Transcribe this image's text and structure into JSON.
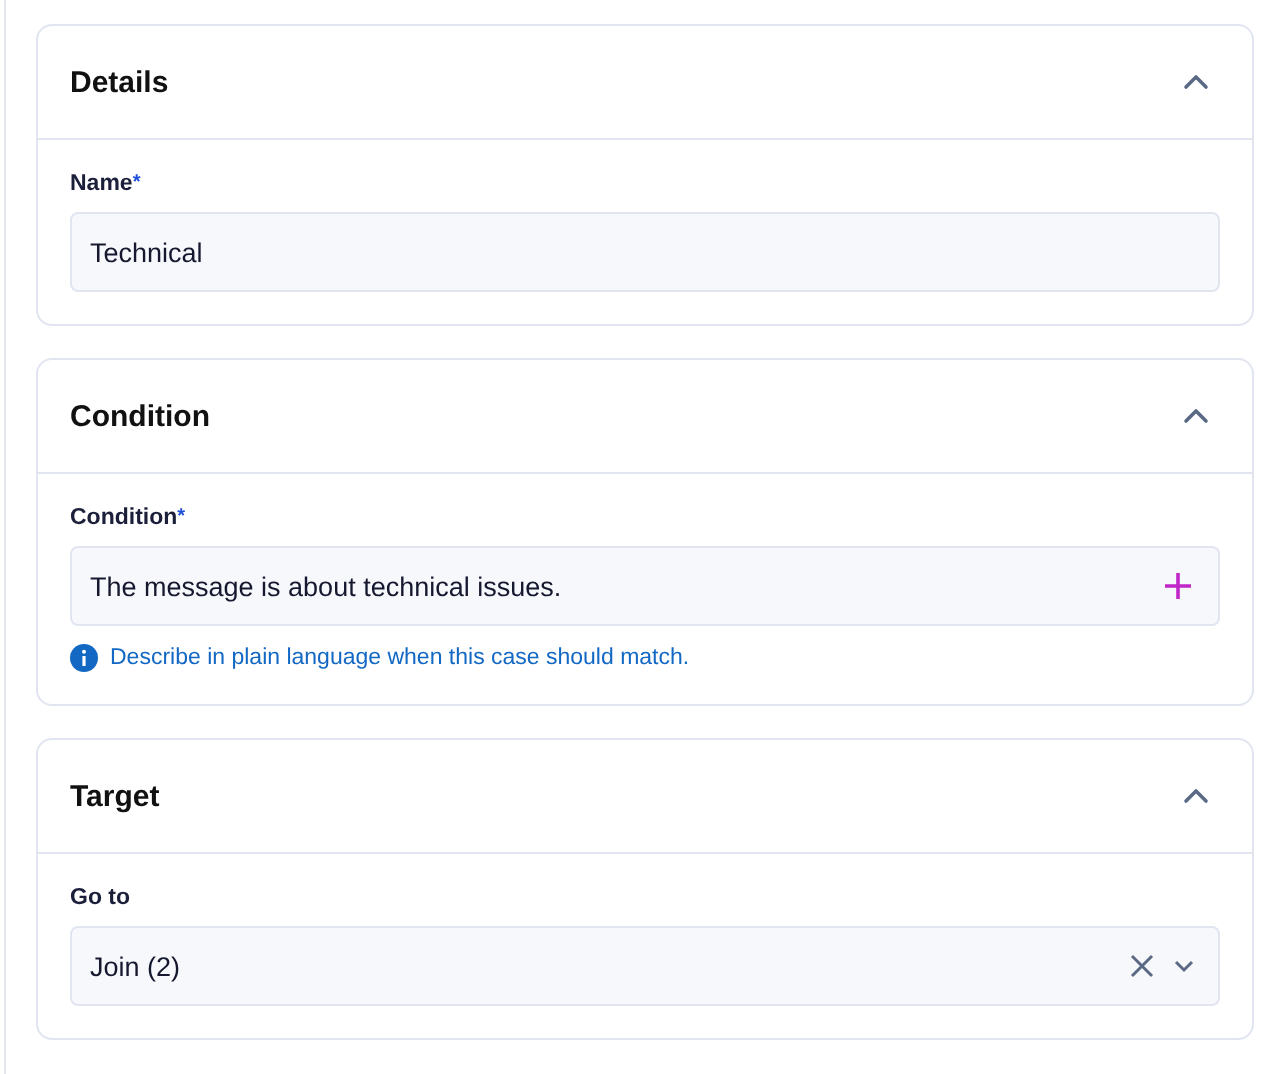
{
  "sections": [
    {
      "title": "Details",
      "expanded": true,
      "field": {
        "kind": "text",
        "label": "Name",
        "required_mark": "*",
        "value": "Technical"
      }
    },
    {
      "title": "Condition",
      "expanded": true,
      "field": {
        "kind": "text_add",
        "label": "Condition",
        "required_mark": "*",
        "value": "The message is about technical issues.",
        "hint": "Describe in plain language when this case should match."
      }
    },
    {
      "title": "Target",
      "expanded": true,
      "field": {
        "kind": "select",
        "label": "Go to",
        "value": "Join (2)"
      }
    }
  ]
}
